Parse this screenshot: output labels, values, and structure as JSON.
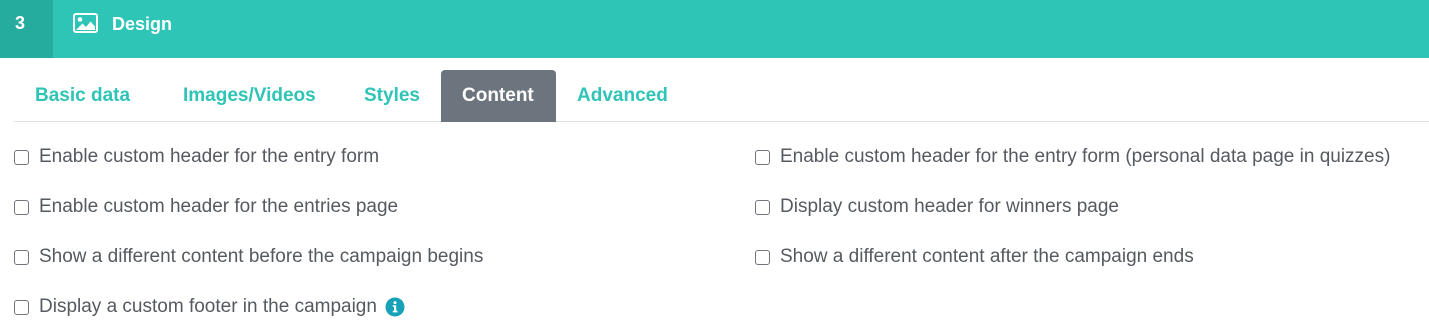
{
  "header": {
    "step_number": "3",
    "icon": "image-icon",
    "title": "Design"
  },
  "tabs": [
    {
      "label": "Basic data",
      "active": false
    },
    {
      "label": "Images/Videos",
      "active": false
    },
    {
      "label": "Styles",
      "active": false
    },
    {
      "label": "Content",
      "active": true
    },
    {
      "label": "Advanced",
      "active": false
    }
  ],
  "options": {
    "left": [
      {
        "label": "Enable custom header for the entry form",
        "checked": false
      },
      {
        "label": "Enable custom header for the entries page",
        "checked": false
      },
      {
        "label": "Show a different content before the campaign begins",
        "checked": false
      },
      {
        "label": "Display a custom footer in the campaign",
        "checked": false,
        "info_icon": "info-icon"
      }
    ],
    "right": [
      {
        "label": "Enable custom header for the entry form (personal data page in quizzes)",
        "checked": false
      },
      {
        "label": "Display custom header for winners page",
        "checked": false
      },
      {
        "label": "Show a different content after the campaign ends",
        "checked": false
      }
    ]
  },
  "colors": {
    "accent": "#2ec4b6",
    "accent_dark": "#26ab9f",
    "active_tab": "#6c757d",
    "info": "#17a2b8"
  }
}
